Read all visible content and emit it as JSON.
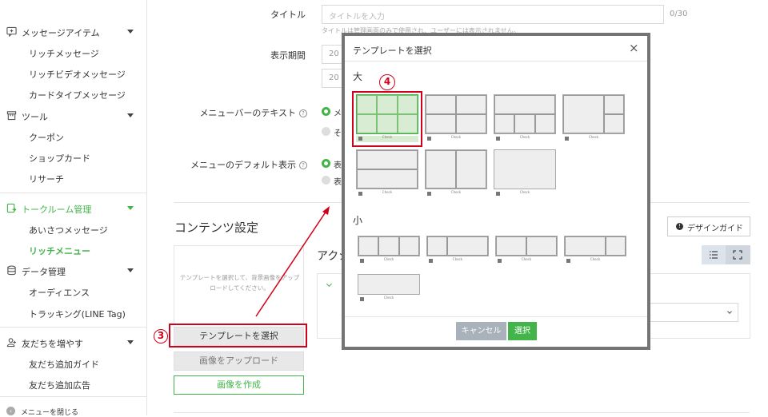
{
  "sidebar": {
    "sections": [
      {
        "label": "メッセージアイテム",
        "icon": "message-icon",
        "items": [
          "リッチメッセージ",
          "リッチビデオメッセージ",
          "カードタイプメッセージ"
        ]
      },
      {
        "label": "ツール",
        "icon": "tool-icon",
        "items": [
          "クーポン",
          "ショップカード",
          "リサーチ"
        ]
      },
      {
        "label": "トークルーム管理",
        "icon": "chatroom-icon",
        "active": true,
        "items": [
          "あいさつメッセージ",
          "リッチメニュー"
        ],
        "active_item": "リッチメニュー"
      },
      {
        "label": "データ管理",
        "icon": "database-icon",
        "items": [
          "オーディエンス",
          "トラッキング(LINE Tag)"
        ]
      },
      {
        "label": "友だちを増やす",
        "icon": "add-friend-icon",
        "items": [
          "友だち追加ガイド",
          "友だち追加広告"
        ]
      }
    ],
    "close_menu_label": "メニューを閉じる"
  },
  "form": {
    "title_label": "タイトル",
    "title_placeholder": "タイトルを入力",
    "title_count": "0/30",
    "title_hint": "タイトルは管理画面のみで使用され、ユーザーには表示されません。",
    "period_label": "表示期間",
    "period_value_1": "20",
    "period_value_2": "20",
    "menubar_label": "メニューバーのテキスト",
    "menubar_option_1": "メ",
    "menubar_option_2": "そ",
    "default_display_label": "メニューのデフォルト表示",
    "default_option_1": "表",
    "default_option_2": "表"
  },
  "content": {
    "heading": "コンテンツ設定",
    "upload_hint": "テンプレートを選択して、背景画像をアップロードしてください。",
    "select_template_button": "テンプレートを選択",
    "upload_image_button": "画像をアップロード",
    "create_image_button": "画像を作成",
    "action_heading_partial": "アクシ",
    "design_guide_button": "デザインガイド"
  },
  "annotations": {
    "step3": "3",
    "step4": "4",
    "color": "#d0021b"
  },
  "modal": {
    "title": "テンプレートを選択",
    "large_label": "大",
    "small_label": "小",
    "template_caption": "Check",
    "cancel_button": "キャンセル",
    "select_button": "選択",
    "large_templates": [
      "6-grid (selected)",
      "4-grid",
      "1-top 3-bottom",
      "1-left 2-right",
      "2-rows",
      "2-cols",
      "full"
    ],
    "small_templates": [
      "3-cols",
      "1-left 2-right",
      "2-cols",
      "1-left 2-right b",
      "full"
    ]
  },
  "colors": {
    "accent": "#42b44a",
    "annotation_red": "#d0021b",
    "modal_border": "#747474"
  }
}
